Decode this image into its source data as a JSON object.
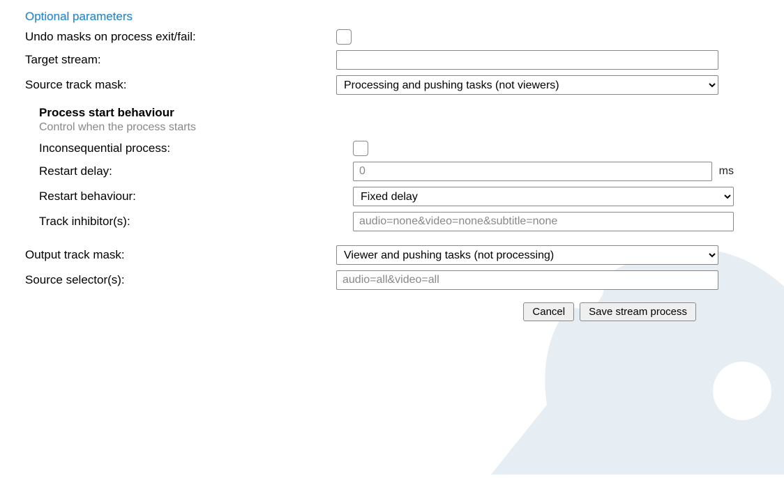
{
  "section_title": "Optional parameters",
  "labels": {
    "undo_masks": "Undo masks on process exit/fail:",
    "target_stream": "Target stream:",
    "source_track_mask": "Source track mask:",
    "output_track_mask": "Output track mask:",
    "source_selector": "Source selector(s):"
  },
  "process_start": {
    "title": "Process start behaviour",
    "description": "Control when the process starts",
    "inconsequential_label": "Inconsequential process:",
    "restart_delay_label": "Restart delay:",
    "restart_delay_placeholder": "0",
    "restart_delay_unit": "ms",
    "restart_behaviour_label": "Restart behaviour:",
    "restart_behaviour_value": "Fixed delay",
    "track_inhibitor_label": "Track inhibitor(s):",
    "track_inhibitor_placeholder": "audio=none&video=none&subtitle=none"
  },
  "fields": {
    "target_stream_value": "",
    "source_track_mask_value": "Processing and pushing tasks (not viewers)",
    "output_track_mask_value": "Viewer and pushing tasks (not processing)",
    "source_selector_placeholder": "audio=all&video=all"
  },
  "buttons": {
    "cancel": "Cancel",
    "save": "Save stream process"
  }
}
